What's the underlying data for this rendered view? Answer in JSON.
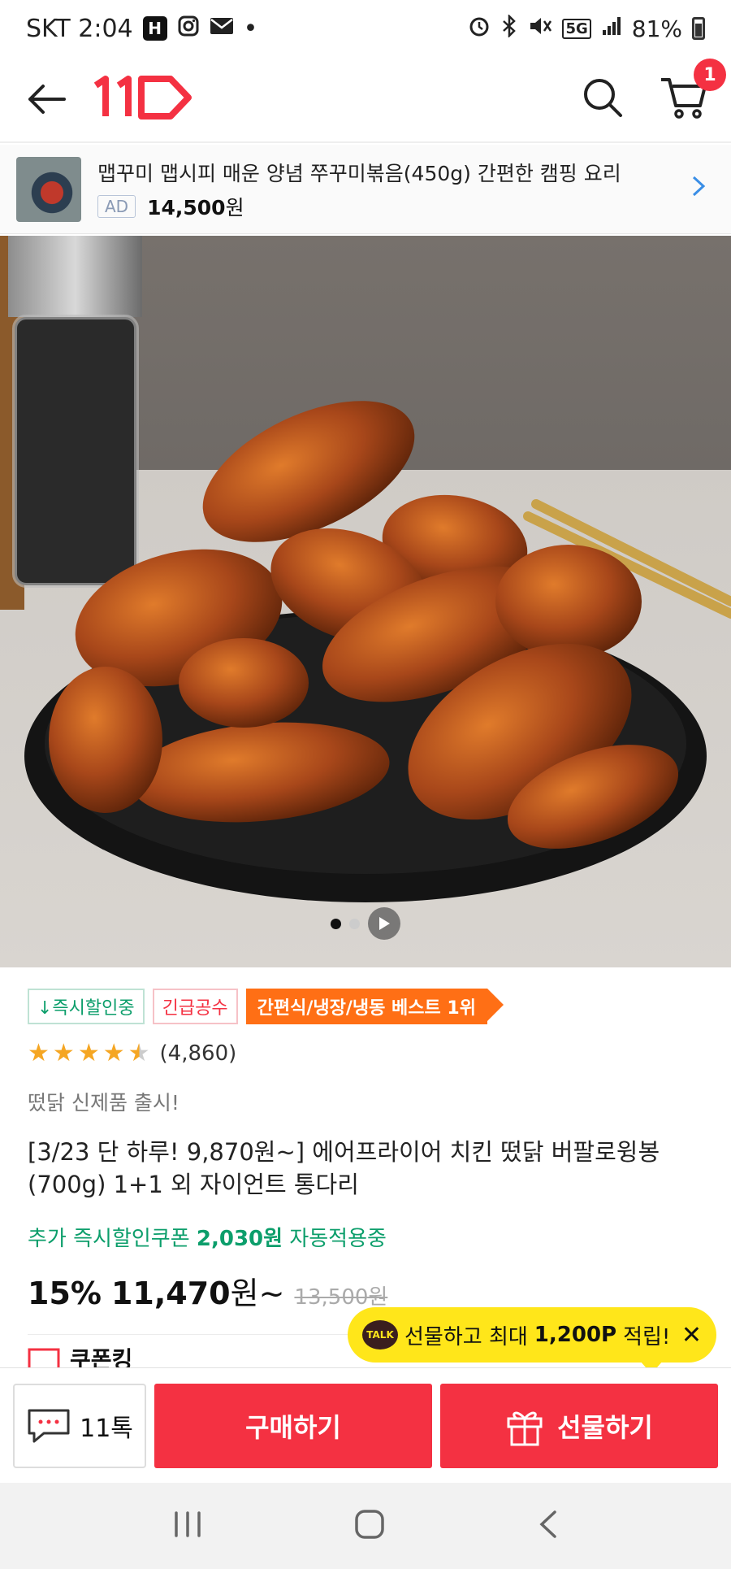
{
  "status_bar": {
    "carrier_time": "SKT 2:04",
    "h_badge": "H",
    "dot": "•",
    "network": "5G",
    "battery": "81%"
  },
  "header": {
    "logo": "11",
    "cart_count": "1"
  },
  "ad_banner": {
    "title": "맵꾸미 맵시피 매운 양념 쭈꾸미볶음(450g) 간편한 캠핑 요리",
    "tag": "AD",
    "price": "14,500",
    "price_unit": "원"
  },
  "gallery": {
    "total_images": 2,
    "current_index": 0
  },
  "product": {
    "badges": [
      "↓즉시할인중",
      "긴급공수",
      "간편식/냉장/냉동 베스트 1위"
    ],
    "rating_stars": 4.5,
    "review_count": "(4,860)",
    "subtitle": "떴닭 신제품 출시!",
    "title": "[3/23 단 하루! 9,870원~] 에어프라이어 치킨 떴닭 버팔로윙봉(700g) 1+1 외 자이언트 통다리",
    "coupon_prefix": "추가 즉시할인쿠폰",
    "coupon_amount": "2,030원",
    "coupon_suffix": "자동적용중",
    "discount": "15%",
    "price": "11,470",
    "price_unit": "원~",
    "original_price": "13,500원",
    "next_section": "쿠폰킹"
  },
  "tooltip": {
    "talk_label": "TALK",
    "text": "선물하고 최대",
    "points": "1,200P",
    "suffix": "적립!",
    "close": "✕"
  },
  "bottom_bar": {
    "talk_label": "11톡",
    "buy_label": "구매하기",
    "gift_label": "선물하기"
  },
  "colors": {
    "brand_red": "#f43142",
    "discount_green": "#0c9e6b",
    "best_orange": "#ff6f15",
    "tooltip_yellow": "#ffe61a"
  }
}
